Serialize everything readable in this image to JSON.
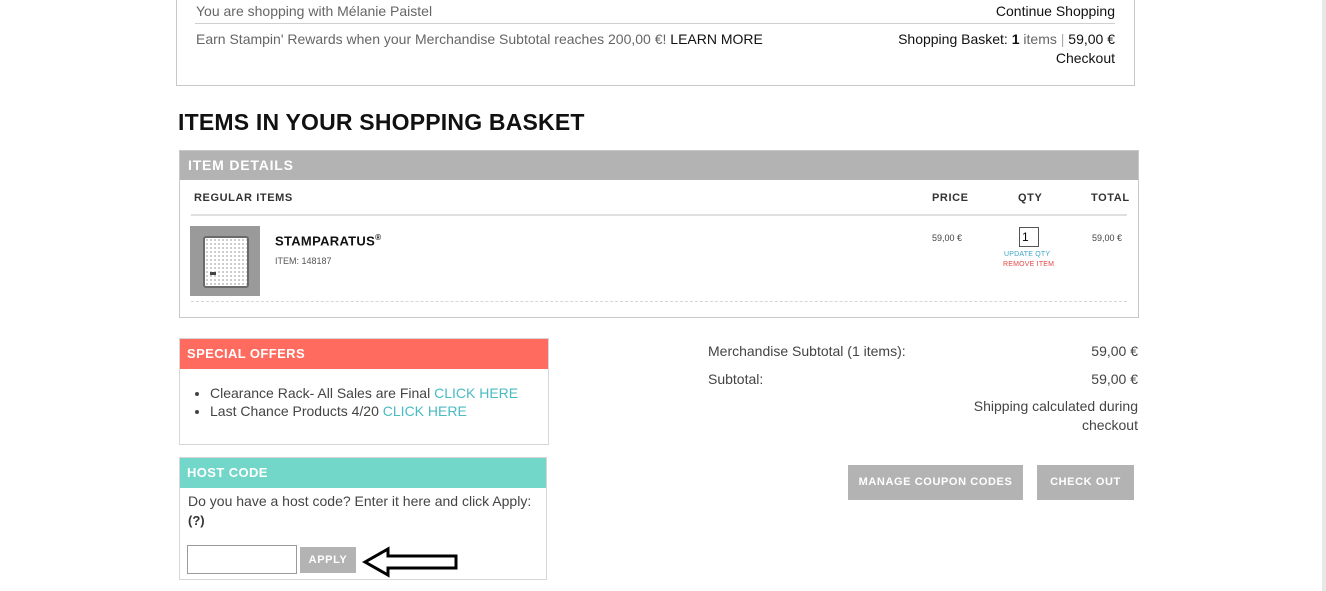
{
  "header": {
    "shopping_with": "You are shopping with Mélanie Paistel",
    "continue_shopping": "Continue Shopping",
    "rewards_text": "Earn Stampin' Rewards when your Merchandise Subtotal reaches 200,00 €!",
    "learn_more": "LEARN MORE",
    "basket_label": "Shopping Basket:",
    "basket_count": "1",
    "basket_items_word": "items",
    "basket_total": "59,00 €",
    "checkout": "Checkout"
  },
  "page_title": "ITEMS IN YOUR SHOPPING BASKET",
  "item_details": {
    "header": "ITEM DETAILS",
    "columns": {
      "regular": "REGULAR ITEMS",
      "price": "PRICE",
      "qty": "QTY",
      "total": "TOTAL"
    },
    "items": [
      {
        "name": "STAMPARATUS",
        "trademark": "®",
        "item_number": "ITEM: 148187",
        "price": "59,00 €",
        "qty": "1",
        "update_qty": "UPDATE QTY",
        "remove_item": "REMOVE ITEM",
        "total": "59,00 €"
      }
    ]
  },
  "special_offers": {
    "header": "SPECIAL OFFERS",
    "items": [
      {
        "text": "Clearance Rack- All Sales are Final",
        "link": "CLICK HERE"
      },
      {
        "text": "Last Chance Products 4/20",
        "link": "CLICK HERE"
      }
    ]
  },
  "host_code": {
    "header": "HOST CODE",
    "prompt": "Do you have a host code? Enter it here and click Apply:",
    "help": "(?)",
    "input_value": "",
    "apply": "APPLY"
  },
  "totals": {
    "merch_label": "Merchandise Subtotal (1 items):",
    "merch_value": "59,00 €",
    "subtotal_label": "Subtotal:",
    "subtotal_value": "59,00 €",
    "shipping_note": "Shipping calculated during checkout"
  },
  "buttons": {
    "manage_coupons": "MANAGE COUPON CODES",
    "check_out": "CHECK OUT"
  },
  "colors": {
    "special_offers_header": "#ff6b5e",
    "host_code_header": "#72d6c8",
    "link": "#48bcc1",
    "remove_link": "#e64545",
    "update_link": "#3aa6c4",
    "button_gray": "#b3b3b3"
  },
  "annotation": {
    "icon": "arrow-left-icon"
  }
}
